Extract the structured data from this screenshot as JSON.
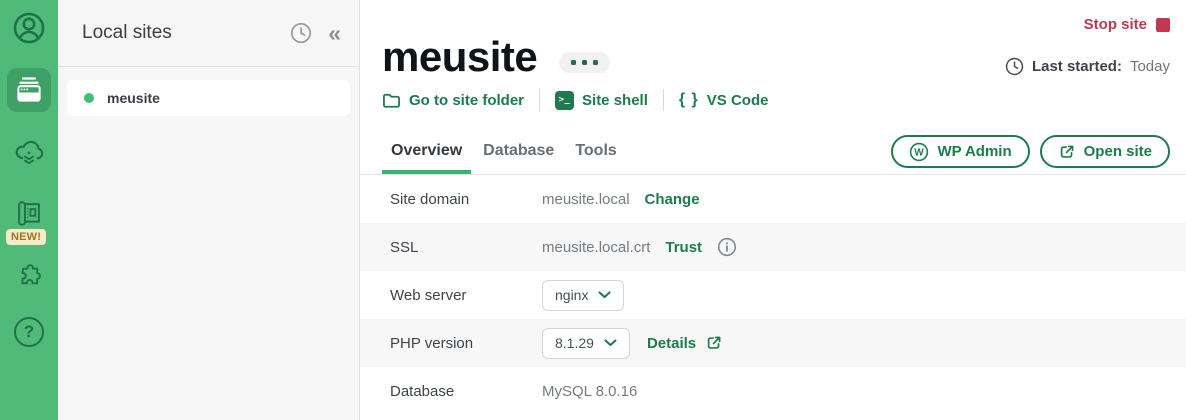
{
  "colors": {
    "sidebar_green": "#50bb79",
    "active_item_green": "#3fa065",
    "accent_green": "#1d7b4e",
    "tab_underline_green": "#3bb273",
    "status_dot_green": "#3fbe78",
    "stop_red": "#bc3a50",
    "new_badge_bg": "#f7ecca",
    "new_badge_text": "#9a761d",
    "panel_bg": "#f6f6f6",
    "row_stripe": "#f7f7f7"
  },
  "icon_glyphs": {
    "collapse": "«",
    "help": "?",
    "terminal": ">_",
    "braces": "{ }",
    "wordpress": "W"
  },
  "sidebar": {
    "items": [
      {
        "name": "account",
        "icon": "avatar"
      },
      {
        "name": "local-sites",
        "icon": "sites-window",
        "active": true
      },
      {
        "name": "cloud-backups",
        "icon": "cloud"
      },
      {
        "name": "blueprints",
        "icon": "blueprint",
        "badge": "NEW!"
      },
      {
        "name": "add-ons",
        "icon": "puzzle"
      },
      {
        "name": "help",
        "icon": "question"
      }
    ]
  },
  "panel": {
    "title": "Local sites",
    "site": {
      "name": "meusite",
      "status": "running"
    }
  },
  "main": {
    "stop_site_label": "Stop site",
    "site_title": "meusite",
    "last_started": {
      "label": "Last started:",
      "value": "Today"
    },
    "actions": {
      "go_to_folder": "Go to site folder",
      "site_shell": "Site shell",
      "vs_code": "VS Code"
    },
    "tabs": [
      {
        "label": "Overview",
        "active": true
      },
      {
        "label": "Database",
        "active": false
      },
      {
        "label": "Tools",
        "active": false
      }
    ],
    "header_buttons": {
      "wp_admin": "WP Admin",
      "open_site": "Open site"
    },
    "rows": [
      {
        "label": "Site domain",
        "value": "meusite.local",
        "link": "Change"
      },
      {
        "label": "SSL",
        "value": "meusite.local.crt",
        "link": "Trust",
        "info": true
      },
      {
        "label": "Web server",
        "dropdown_value": "nginx"
      },
      {
        "label": "PHP version",
        "dropdown_value": "8.1.29",
        "link": "Details",
        "external": true
      },
      {
        "label": "Database",
        "value": "MySQL 8.0.16"
      }
    ]
  }
}
